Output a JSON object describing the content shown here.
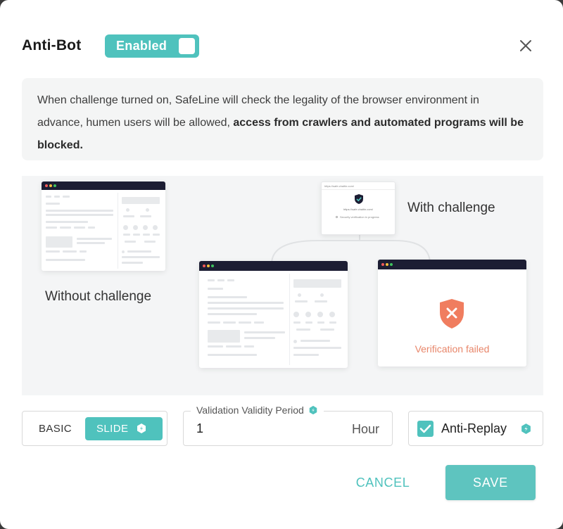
{
  "dialog": {
    "title": "Anti-Bot",
    "toggle_label": "Enabled",
    "toggle_on": true,
    "close_icon": "close-icon"
  },
  "info": {
    "text_normal": "When challenge turned on, SafeLine will check the legality of the browser environment in advance, humen users will be allowed, ",
    "text_bold": "access from crawlers and automated programs will be blocked."
  },
  "illustration": {
    "without_caption": "Without challenge",
    "with_caption": "With challenge",
    "failed_caption": "Verification failed",
    "popup_url": "https://safe.chaitin.com/",
    "popup_domain": "https://safe.chaitin.com/",
    "popup_status": "Security verification in progress"
  },
  "mode": {
    "basic_label": "BASIC",
    "slide_label": "SLIDE",
    "selected": "SLIDE",
    "pro_icon": "pro-badge-icon"
  },
  "validity": {
    "label": "Validation Validity Period",
    "value": "1",
    "unit": "Hour"
  },
  "anti_replay": {
    "label": "Anti-Replay",
    "checked": true
  },
  "actions": {
    "cancel_label": "CANCEL",
    "save_label": "SAVE"
  },
  "colors": {
    "accent": "#4fc2bd",
    "fail": "#e8866a",
    "shield_fail": "#f07d5f",
    "window_bar": "#1c1d33"
  }
}
